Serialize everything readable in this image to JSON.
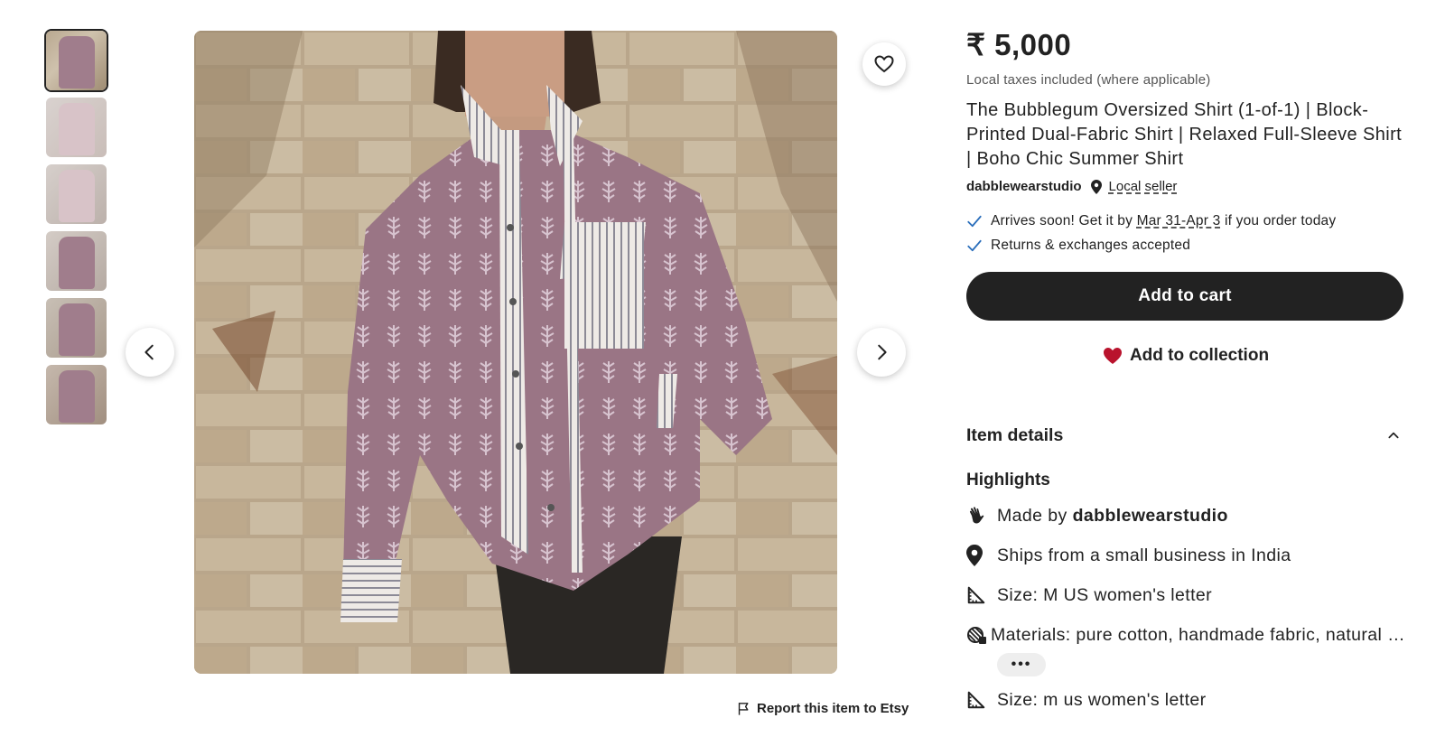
{
  "gallery": {
    "thumbnails": [
      "thumb-1",
      "thumb-2",
      "thumb-3",
      "thumb-4",
      "thumb-5",
      "thumb-6"
    ],
    "selected_index": 0,
    "report_label": "Report this item to Etsy"
  },
  "product": {
    "price": "₹ 5,000",
    "tax_note": "Local taxes included (where applicable)",
    "title": "The Bubblegum Oversized Shirt (1-of-1) | Block-Printed Dual-Fabric Shirt | Relaxed Full-Sleeve Shirt | Boho Chic Summer Shirt",
    "seller": "dabblewearstudio",
    "local_seller_label": "Local seller"
  },
  "perks": {
    "arrival_prefix": "Arrives soon! Get it by",
    "arrival_dates": "Mar 31-Apr 3",
    "arrival_suffix": "if you order today",
    "returns": "Returns & exchanges accepted"
  },
  "actions": {
    "add_to_cart": "Add to cart",
    "add_to_collection": "Add to collection"
  },
  "details": {
    "heading": "Item details",
    "highlights_heading": "Highlights",
    "made_by_prefix": "Made by",
    "made_by_name": "dabblewearstudio",
    "ships_from": "Ships from a small business in India",
    "size": "Size: M US women's letter",
    "materials": "Materials: pure cotton, handmade fabric, natural …",
    "more": "•••",
    "size2": "Size: m us women's letter"
  },
  "colors": {
    "primary": "#222222",
    "heart_red": "#b9132d",
    "check_blue": "#2a6ebb"
  }
}
